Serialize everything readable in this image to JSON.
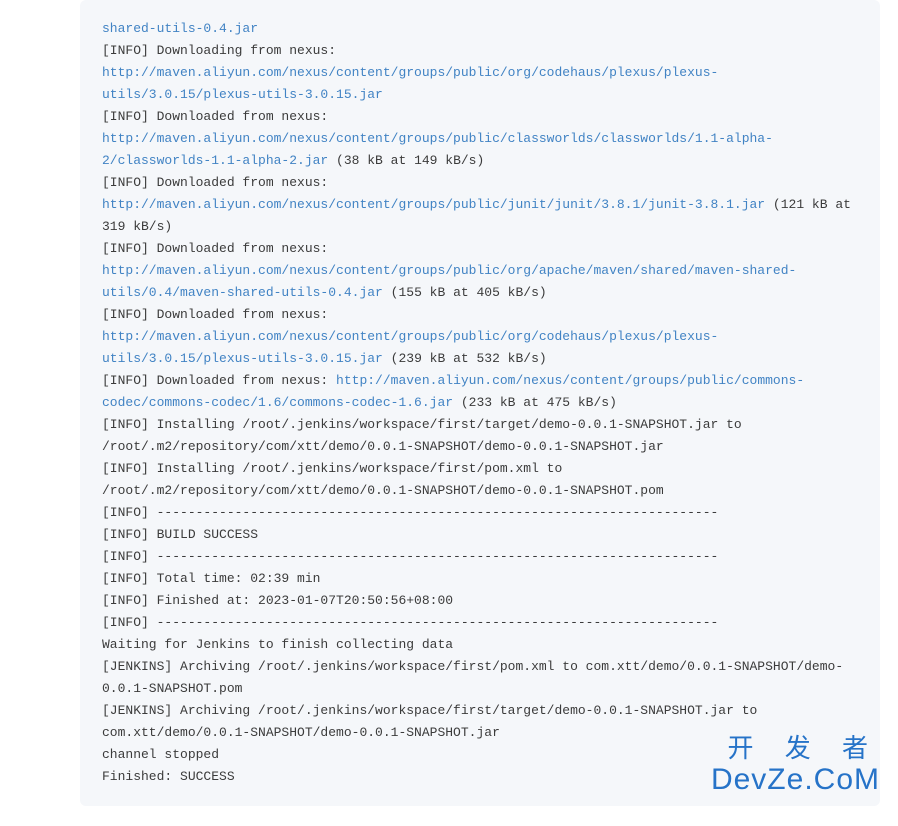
{
  "console": {
    "lines": [
      {
        "segments": [
          {
            "type": "link",
            "text": "shared-utils-0.4.jar"
          }
        ]
      },
      {
        "segments": [
          {
            "type": "text",
            "text": "[INFO] Downloading from nexus: "
          }
        ]
      },
      {
        "segments": [
          {
            "type": "link",
            "text": "http://maven.aliyun.com/nexus/content/groups/public/org/codehaus/plexus/plexus-utils/3.0.15/plexus-utils-3.0.15.jar"
          }
        ]
      },
      {
        "segments": [
          {
            "type": "text",
            "text": "[INFO] Downloaded from nexus: "
          }
        ]
      },
      {
        "segments": [
          {
            "type": "link",
            "text": "http://maven.aliyun.com/nexus/content/groups/public/classworlds/classworlds/1.1-alpha-2/classworlds-1.1-alpha-2.jar"
          },
          {
            "type": "text",
            "text": " (38 kB at 149 kB/s)"
          }
        ]
      },
      {
        "segments": [
          {
            "type": "text",
            "text": "[INFO] Downloaded from nexus: "
          },
          {
            "type": "link",
            "text": "http://maven.aliyun.com/nexus/content/groups/public/junit/junit/3.8.1/junit-3.8.1.jar"
          },
          {
            "type": "text",
            "text": " (121 kB at 319 kB/s)"
          }
        ]
      },
      {
        "segments": [
          {
            "type": "text",
            "text": "[INFO] Downloaded from nexus: "
          }
        ]
      },
      {
        "segments": [
          {
            "type": "link",
            "text": "http://maven.aliyun.com/nexus/content/groups/public/org/apache/maven/shared/maven-shared-utils/0.4/maven-shared-utils-0.4.jar"
          },
          {
            "type": "text",
            "text": " (155 kB at 405 kB/s)"
          }
        ]
      },
      {
        "segments": [
          {
            "type": "text",
            "text": "[INFO] Downloaded from nexus: "
          }
        ]
      },
      {
        "segments": [
          {
            "type": "link",
            "text": "http://maven.aliyun.com/nexus/content/groups/public/org/codehaus/plexus/plexus-utils/3.0.15/plexus-utils-3.0.15.jar"
          },
          {
            "type": "text",
            "text": " (239 kB at 532 kB/s)"
          }
        ]
      },
      {
        "segments": [
          {
            "type": "text",
            "text": "[INFO] Downloaded from nexus: "
          },
          {
            "type": "link",
            "text": "http://maven.aliyun.com/nexus/content/groups/public/commons-codec/commons-codec/1.6/commons-codec-1.6.jar"
          },
          {
            "type": "text",
            "text": " (233 kB at 475 kB/s)"
          }
        ]
      },
      {
        "segments": [
          {
            "type": "text",
            "text": "[INFO] Installing /root/.jenkins/workspace/first/target/demo-0.0.1-SNAPSHOT.jar to /root/.m2/repository/com/xtt/demo/0.0.1-SNAPSHOT/demo-0.0.1-SNAPSHOT.jar"
          }
        ]
      },
      {
        "segments": [
          {
            "type": "text",
            "text": "[INFO] Installing /root/.jenkins/workspace/first/pom.xml to /root/.m2/repository/com/xtt/demo/0.0.1-SNAPSHOT/demo-0.0.1-SNAPSHOT.pom"
          }
        ]
      },
      {
        "segments": [
          {
            "type": "text",
            "text": "[INFO] ------------------------------------------------------------------------"
          }
        ]
      },
      {
        "segments": [
          {
            "type": "text",
            "text": "[INFO] BUILD SUCCESS"
          }
        ]
      },
      {
        "segments": [
          {
            "type": "text",
            "text": "[INFO] ------------------------------------------------------------------------"
          }
        ]
      },
      {
        "segments": [
          {
            "type": "text",
            "text": "[INFO] Total time:  02:39 min"
          }
        ]
      },
      {
        "segments": [
          {
            "type": "text",
            "text": "[INFO] Finished at: 2023-01-07T20:50:56+08:00"
          }
        ]
      },
      {
        "segments": [
          {
            "type": "text",
            "text": "[INFO] ------------------------------------------------------------------------"
          }
        ]
      },
      {
        "segments": [
          {
            "type": "text",
            "text": "Waiting for Jenkins to finish collecting data"
          }
        ]
      },
      {
        "segments": [
          {
            "type": "text",
            "text": "[JENKINS] Archiving /root/.jenkins/workspace/first/pom.xml to com.xtt/demo/0.0.1-SNAPSHOT/demo-0.0.1-SNAPSHOT.pom"
          }
        ]
      },
      {
        "segments": [
          {
            "type": "text",
            "text": "[JENKINS] Archiving /root/.jenkins/workspace/first/target/demo-0.0.1-SNAPSHOT.jar to com.xtt/demo/0.0.1-SNAPSHOT/demo-0.0.1-SNAPSHOT.jar"
          }
        ]
      },
      {
        "segments": [
          {
            "type": "text",
            "text": "channel stopped"
          }
        ]
      },
      {
        "segments": [
          {
            "type": "text",
            "text": "Finished: SUCCESS"
          }
        ]
      }
    ]
  },
  "watermark": {
    "cn": "开 发 者",
    "en": "DevZe.CoM"
  }
}
